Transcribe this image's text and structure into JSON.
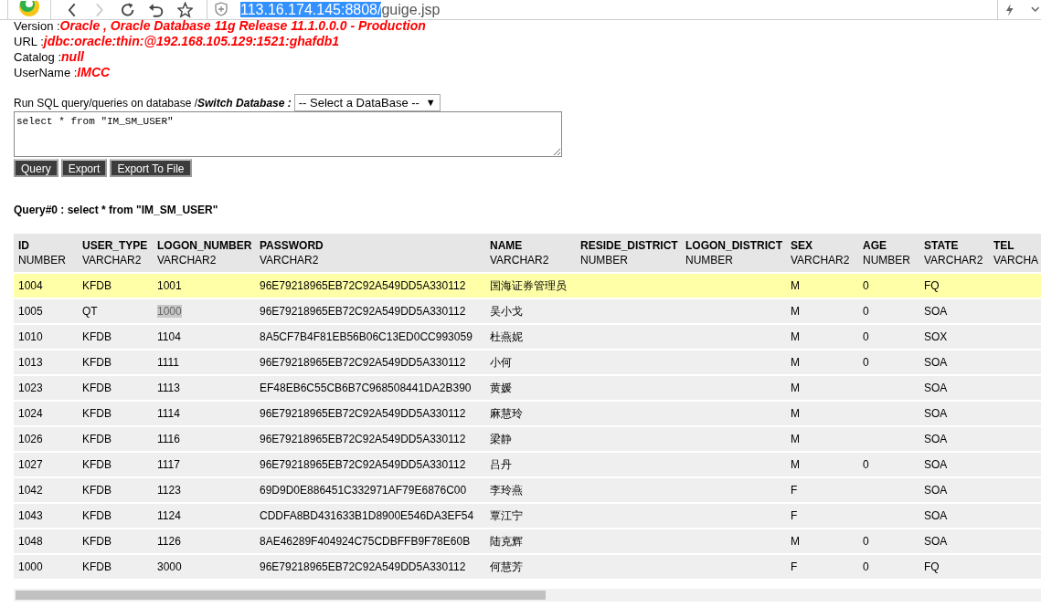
{
  "browser": {
    "url_selected": "113.16.174.145:8808/",
    "url_rest": "guige.jsp"
  },
  "info": [
    {
      "label": "Version : ",
      "value": "Oracle , Oracle Database 11g Release 11.1.0.0.0 - Production"
    },
    {
      "label": "URL : ",
      "value": "jdbc:oracle:thin:@192.168.105.129:1521:ghafdb1"
    },
    {
      "label": "Catalog : ",
      "value": "null"
    },
    {
      "label": "UserName : ",
      "value": "IMCC"
    }
  ],
  "query_form": {
    "prompt": "Run SQL query/queries on database / ",
    "switch_label": "Switch Database :",
    "select_value": "-- Select a DataBase --",
    "select_arrow": "▼",
    "sql": "select * from \"IM_SM_USER\"",
    "buttons": [
      "Query",
      "Export",
      "Export To File"
    ]
  },
  "result_title": "Query#0 : select * from \"IM_SM_USER\"",
  "table": {
    "columns": [
      {
        "name": "ID",
        "type": "NUMBER"
      },
      {
        "name": "USER_TYPE",
        "type": "VARCHAR2"
      },
      {
        "name": "LOGON_NUMBER",
        "type": "VARCHAR2"
      },
      {
        "name": "PASSWORD",
        "type": "VARCHAR2"
      },
      {
        "name": "NAME",
        "type": "VARCHAR2"
      },
      {
        "name": "RESIDE_DISTRICT",
        "type": "NUMBER"
      },
      {
        "name": "LOGON_DISTRICT",
        "type": "NUMBER"
      },
      {
        "name": "SEX",
        "type": "VARCHAR2"
      },
      {
        "name": "AGE",
        "type": "NUMBER"
      },
      {
        "name": "STATE",
        "type": "VARCHAR2"
      },
      {
        "name": "TEL",
        "type": "VARCHA"
      }
    ],
    "rows": [
      {
        "selected": true,
        "logon_number_marked": false,
        "cells": [
          "1004",
          "KFDB",
          "1001",
          "96E79218965EB72C92A549DD5A330112",
          "国海证券管理员",
          "",
          "",
          "M",
          "0",
          "FQ",
          ""
        ]
      },
      {
        "selected": false,
        "logon_number_marked": true,
        "cells": [
          "1005",
          "QT",
          "1000",
          "96E79218965EB72C92A549DD5A330112",
          "吴小戈",
          "",
          "",
          "M",
          "0",
          "SOA",
          ""
        ]
      },
      {
        "selected": false,
        "logon_number_marked": false,
        "cells": [
          "1010",
          "KFDB",
          "1104",
          "8A5CF7B4F81EB56B06C13ED0CC993059",
          "杜燕妮",
          "",
          "",
          "M",
          "0",
          "SOX",
          ""
        ]
      },
      {
        "selected": false,
        "logon_number_marked": false,
        "cells": [
          "1013",
          "KFDB",
          "1111",
          "96E79218965EB72C92A549DD5A330112",
          "小何",
          "",
          "",
          "M",
          "0",
          "SOA",
          ""
        ]
      },
      {
        "selected": false,
        "logon_number_marked": false,
        "cells": [
          "1023",
          "KFDB",
          "1113",
          "EF48EB6C55CB6B7C968508441DA2B390",
          "黄媛",
          "",
          "",
          "M",
          "",
          "SOA",
          ""
        ]
      },
      {
        "selected": false,
        "logon_number_marked": false,
        "cells": [
          "1024",
          "KFDB",
          "1114",
          "96E79218965EB72C92A549DD5A330112",
          "麻慧玲",
          "",
          "",
          "M",
          "",
          "SOA",
          ""
        ]
      },
      {
        "selected": false,
        "logon_number_marked": false,
        "cells": [
          "1026",
          "KFDB",
          "1116",
          "96E79218965EB72C92A549DD5A330112",
          "梁静",
          "",
          "",
          "M",
          "",
          "SOA",
          ""
        ]
      },
      {
        "selected": false,
        "logon_number_marked": false,
        "cells": [
          "1027",
          "KFDB",
          "1117",
          "96E79218965EB72C92A549DD5A330112",
          "吕丹",
          "",
          "",
          "M",
          "0",
          "SOA",
          ""
        ]
      },
      {
        "selected": false,
        "logon_number_marked": false,
        "cells": [
          "1042",
          "KFDB",
          "1123",
          "69D9D0E886451C332971AF79E6876C00",
          "李玲燕",
          "",
          "",
          "F",
          "",
          "SOA",
          ""
        ]
      },
      {
        "selected": false,
        "logon_number_marked": false,
        "cells": [
          "1043",
          "KFDB",
          "1124",
          "CDDFA8BD431633B1D8900E546DA3EF54",
          "覃江宁",
          "",
          "",
          "F",
          "",
          "SOA",
          ""
        ]
      },
      {
        "selected": false,
        "logon_number_marked": false,
        "cells": [
          "1048",
          "KFDB",
          "1126",
          "8AE46289F404924C75CDBFFB9F78E60B",
          "陆克辉",
          "",
          "",
          "M",
          "0",
          "SOA",
          ""
        ]
      },
      {
        "selected": false,
        "logon_number_marked": false,
        "cells": [
          "1000",
          "KFDB",
          "3000",
          "96E79218965EB72C92A549DD5A330112",
          "何慧芳",
          "",
          "",
          "F",
          "0",
          "FQ",
          ""
        ]
      }
    ]
  }
}
